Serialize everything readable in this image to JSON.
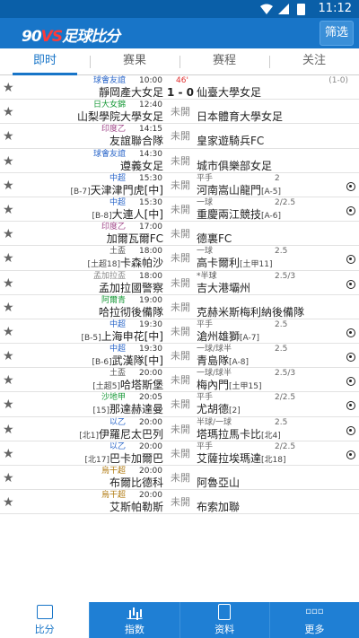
{
  "status_bar": {
    "time": "11:12"
  },
  "header": {
    "logo_prefix": "90",
    "logo_vs": "VS",
    "logo_suffix": "足球比分",
    "filter_label": "筛选"
  },
  "tabs": [
    {
      "label": "即时"
    },
    {
      "label": "赛果"
    },
    {
      "label": "赛程"
    },
    {
      "label": "关注"
    }
  ],
  "colors": {
    "accent": "#1875c8",
    "live_minute": "#e03030"
  },
  "matches": [
    {
      "league": "球會友誼",
      "league_color": "#2a66c9",
      "time": "10:00",
      "minute": "46'",
      "home": "靜岡產大女足",
      "score": "1 - 0",
      "status": "",
      "away": "仙臺大學女足",
      "handicap": "",
      "ou": "",
      "extra": "(1-0)",
      "ball": false
    },
    {
      "league": "日大女錦",
      "league_color": "#1a9a3a",
      "time": "12:40",
      "minute": "",
      "home": "山梨學院大學女足",
      "score": "",
      "status": "未開",
      "away": "日本體育大學女足",
      "handicap": "",
      "ou": "",
      "extra": "",
      "ball": false
    },
    {
      "league": "印度乙",
      "league_color": "#a0488a",
      "time": "14:15",
      "minute": "",
      "home": "友誼聯合隊",
      "score": "",
      "status": "未開",
      "away": "皇家遊騎兵FC",
      "handicap": "",
      "ou": "",
      "extra": "",
      "ball": false
    },
    {
      "league": "球會友誼",
      "league_color": "#2a66c9",
      "time": "14:30",
      "minute": "",
      "home": "遵義女足",
      "score": "",
      "status": "未開",
      "away": "城市俱樂部女足",
      "handicap": "",
      "ou": "",
      "extra": "",
      "ball": false
    },
    {
      "league": "中超",
      "league_color": "#2a66c9",
      "time": "15:30",
      "minute": "",
      "home_rank": "[B-7]",
      "home": "天津津門虎[中]",
      "score": "",
      "status": "未開",
      "away": "河南嵩山龍門",
      "away_rank": "[A-5]",
      "handicap": "平手",
      "ou": "2",
      "extra": "",
      "ball": true
    },
    {
      "league": "中超",
      "league_color": "#2a66c9",
      "time": "15:30",
      "minute": "",
      "home_rank": "[B-8]",
      "home": "大連人[中]",
      "score": "",
      "status": "未開",
      "away": "重慶兩江競技",
      "away_rank": "[A-6]",
      "handicap": "一球",
      "ou": "2/2.5",
      "extra": "",
      "ball": true
    },
    {
      "league": "印度乙",
      "league_color": "#a0488a",
      "time": "17:00",
      "minute": "",
      "home": "加爾瓦爾FC",
      "score": "",
      "status": "未開",
      "away": "德裏FC",
      "handicap": "",
      "ou": "",
      "extra": "",
      "ball": false
    },
    {
      "league": "土盃",
      "league_color": "#555555",
      "time": "18:00",
      "minute": "",
      "home_rank": "[土超18]",
      "home": "卡森帕沙",
      "score": "",
      "status": "未開",
      "away": "高卡爾利",
      "away_rank": "[土甲11]",
      "handicap": "一球",
      "ou": "2.5",
      "extra": "",
      "ball": true
    },
    {
      "league": "孟加拉盃",
      "league_color": "#888888",
      "time": "18:00",
      "minute": "",
      "home": "孟加拉國警察",
      "score": "",
      "status": "未開",
      "away": "吉大港壩州",
      "handicap": "*半球",
      "ou": "2.5/3",
      "extra": "",
      "ball": true
    },
    {
      "league": "阿爾青",
      "league_color": "#1a9a3a",
      "time": "19:00",
      "minute": "",
      "home": "哈拉彻後備隊",
      "score": "",
      "status": "未開",
      "away": "克赫米斯梅利納後備隊",
      "handicap": "",
      "ou": "",
      "extra": "",
      "ball": false
    },
    {
      "league": "中超",
      "league_color": "#2a66c9",
      "time": "19:30",
      "minute": "",
      "home_rank": "[B-5]",
      "home": "上海申花[中]",
      "score": "",
      "status": "未開",
      "away": "滄州雄獅",
      "away_rank": "[A-7]",
      "handicap": "平手",
      "ou": "2.5",
      "extra": "",
      "ball": true
    },
    {
      "league": "中超",
      "league_color": "#2a66c9",
      "time": "19:30",
      "minute": "",
      "home_rank": "[B-6]",
      "home": "武漢隊[中]",
      "score": "",
      "status": "未開",
      "away": "青島隊",
      "away_rank": "[A-8]",
      "handicap": "一球/球半",
      "ou": "2.5",
      "extra": "",
      "ball": true
    },
    {
      "league": "土盃",
      "league_color": "#555555",
      "time": "20:00",
      "minute": "",
      "home_rank": "[土超5]",
      "home": "哈塔斯堡",
      "score": "",
      "status": "未開",
      "away": "梅內門",
      "away_rank": "[土甲15]",
      "handicap": "一球/球半",
      "ou": "2.5/3",
      "extra": "",
      "ball": true
    },
    {
      "league": "沙地甲",
      "league_color": "#1a9a3a",
      "time": "20:05",
      "minute": "",
      "home_rank": "[15]",
      "home": "那達赫達曼",
      "score": "",
      "status": "未開",
      "away": "尤胡德",
      "away_rank": "[2]",
      "handicap": "平手",
      "ou": "2/2.5",
      "extra": "",
      "ball": true
    },
    {
      "league": "以乙",
      "league_color": "#2a66c9",
      "time": "20:00",
      "minute": "",
      "home_rank": "[北1]",
      "home": "伊羅尼太巴列",
      "score": "",
      "status": "未開",
      "away": "塔瑪拉馬卡比",
      "away_rank": "[北4]",
      "handicap": "半球/一球",
      "ou": "2.5",
      "extra": "",
      "ball": true
    },
    {
      "league": "以乙",
      "league_color": "#2a66c9",
      "time": "20:00",
      "minute": "",
      "home_rank": "[北17]",
      "home": "巴卡加爾巴",
      "score": "",
      "status": "未開",
      "away": "艾薩拉埃瑪達",
      "away_rank": "[北18]",
      "handicap": "平手",
      "ou": "2/2.5",
      "extra": "",
      "ball": true
    },
    {
      "league": "烏干超",
      "league_color": "#b07a10",
      "time": "20:00",
      "minute": "",
      "home": "布爾比德科",
      "score": "",
      "status": "未開",
      "away": "阿魯亞山",
      "handicap": "",
      "ou": "",
      "extra": "",
      "ball": false
    },
    {
      "league": "烏干超",
      "league_color": "#b07a10",
      "time": "20:00",
      "minute": "",
      "home": "艾斯帕勒斯",
      "score": "",
      "status": "未開",
      "away": "布索加聯",
      "handicap": "",
      "ou": "",
      "extra": "",
      "ball": false
    }
  ],
  "bottom_nav": [
    {
      "label": "比分"
    },
    {
      "label": "指数"
    },
    {
      "label": "资料"
    },
    {
      "label": "更多"
    }
  ]
}
